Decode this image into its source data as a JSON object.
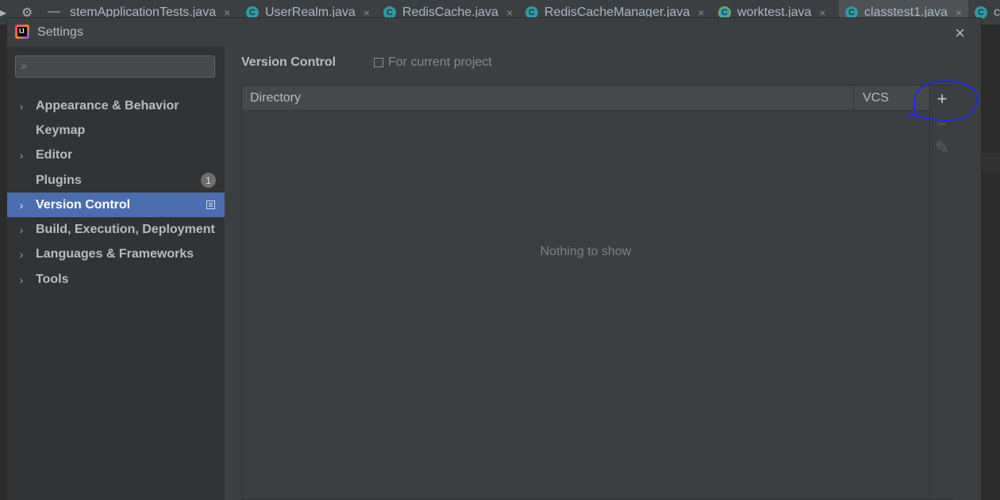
{
  "ide": {
    "tabs": [
      {
        "label": "stemApplicationTests.java",
        "close": "×"
      },
      {
        "label": "UserRealm.java",
        "close": "×",
        "icon": "C"
      },
      {
        "label": "RedisCache.java",
        "close": "×",
        "icon": "C"
      },
      {
        "label": "RedisCacheManager.java",
        "close": "×",
        "icon": "C"
      },
      {
        "label": "worktest.java",
        "close": "×",
        "icon": "C"
      },
      {
        "label": "classtest1.java",
        "close": "×",
        "icon": "C"
      },
      {
        "label": "c",
        "icon": "C"
      }
    ],
    "tools": {
      "gear": "⚙",
      "minimize": "—"
    }
  },
  "dialog": {
    "title": "Settings",
    "close_glyph": "×"
  },
  "sidebar": {
    "search": {
      "value": "",
      "placeholder": "",
      "icon": "search-icon"
    },
    "items": [
      {
        "label": "Appearance & Behavior",
        "expandable": true
      },
      {
        "label": "Keymap",
        "expandable": false
      },
      {
        "label": "Editor",
        "expandable": true
      },
      {
        "label": "Plugins",
        "expandable": false,
        "badge": "1"
      },
      {
        "label": "Version Control",
        "expandable": true,
        "selected": true,
        "project_scope_icon": "project-icon"
      },
      {
        "label": "Build, Execution, Deployment",
        "expandable": true
      },
      {
        "label": "Languages & Frameworks",
        "expandable": true
      },
      {
        "label": "Tools",
        "expandable": true
      }
    ],
    "chevron": "›"
  },
  "main": {
    "title": "Version Control",
    "scope_hint": "For current project",
    "table": {
      "columns": [
        "Directory",
        "VCS"
      ],
      "rows": [],
      "empty_text": "Nothing to show"
    },
    "toolbar": {
      "add": "+",
      "remove": "−",
      "edit": "✎"
    }
  },
  "colors": {
    "selection": "#4b6eaf",
    "annotation": "#1d2fd6"
  }
}
